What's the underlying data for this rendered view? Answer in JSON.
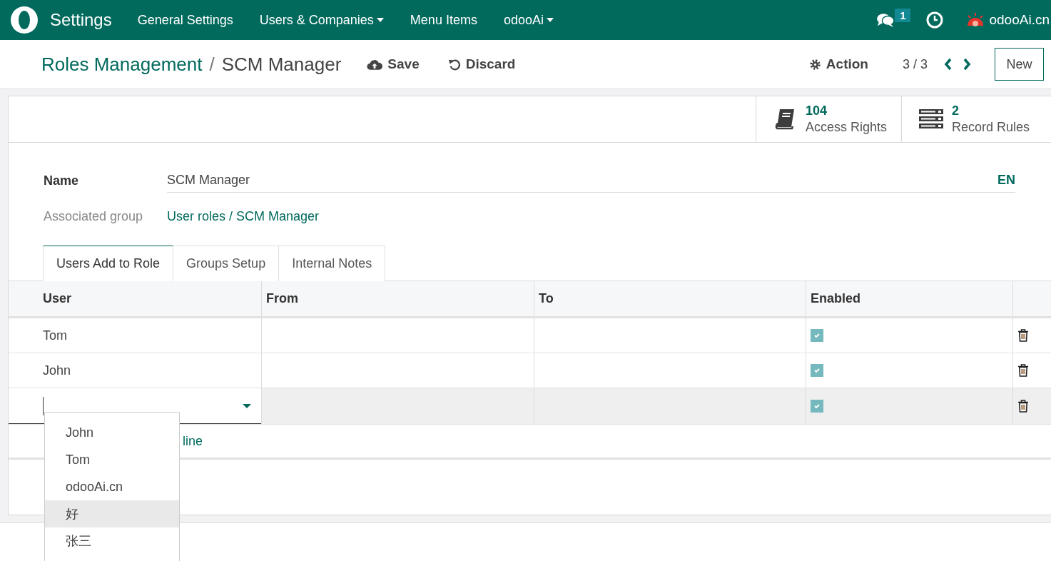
{
  "navbar": {
    "app": "Settings",
    "menus": [
      {
        "label": "General Settings",
        "dropdown": false
      },
      {
        "label": "Users & Companies",
        "dropdown": true
      },
      {
        "label": "Menu Items",
        "dropdown": false
      },
      {
        "label": "odooAi",
        "dropdown": true
      }
    ],
    "messages_count": "1",
    "user": "odooAi.cn"
  },
  "breadcrumb": {
    "parent": "Roles Management",
    "separator": "/",
    "current": "SCM Manager"
  },
  "actions": {
    "save": "Save",
    "discard": "Discard",
    "action": "Action",
    "pager": "3 / 3",
    "new": "New"
  },
  "stat_buttons": [
    {
      "kind": "book",
      "count": "104",
      "label": "Access Rights"
    },
    {
      "kind": "server",
      "count": "2",
      "label": "Record Rules"
    }
  ],
  "fields": {
    "name_label": "Name",
    "name_value": "SCM Manager",
    "lang": "EN",
    "group_label": "Associated group",
    "group_value": "User roles / SCM Manager"
  },
  "tabs": [
    {
      "label": "Users Add to Role",
      "selected": true
    },
    {
      "label": "Groups Setup",
      "selected": false
    },
    {
      "label": "Internal Notes",
      "selected": false
    }
  ],
  "table": {
    "columns": [
      "User",
      "From",
      "To",
      "Enabled"
    ],
    "rows": [
      {
        "user": "Tom",
        "enabled": true,
        "editing": false
      },
      {
        "user": "John",
        "enabled": true,
        "editing": false
      },
      {
        "enabled": true,
        "editing": true
      }
    ]
  },
  "add_line": "line",
  "dropdown": {
    "items": [
      {
        "label": "John",
        "selected": false
      },
      {
        "label": "Tom",
        "selected": false
      },
      {
        "label": "odooAi.cn",
        "selected": false
      },
      {
        "label": "好",
        "selected": true
      },
      {
        "label": "张三",
        "selected": false
      }
    ]
  }
}
